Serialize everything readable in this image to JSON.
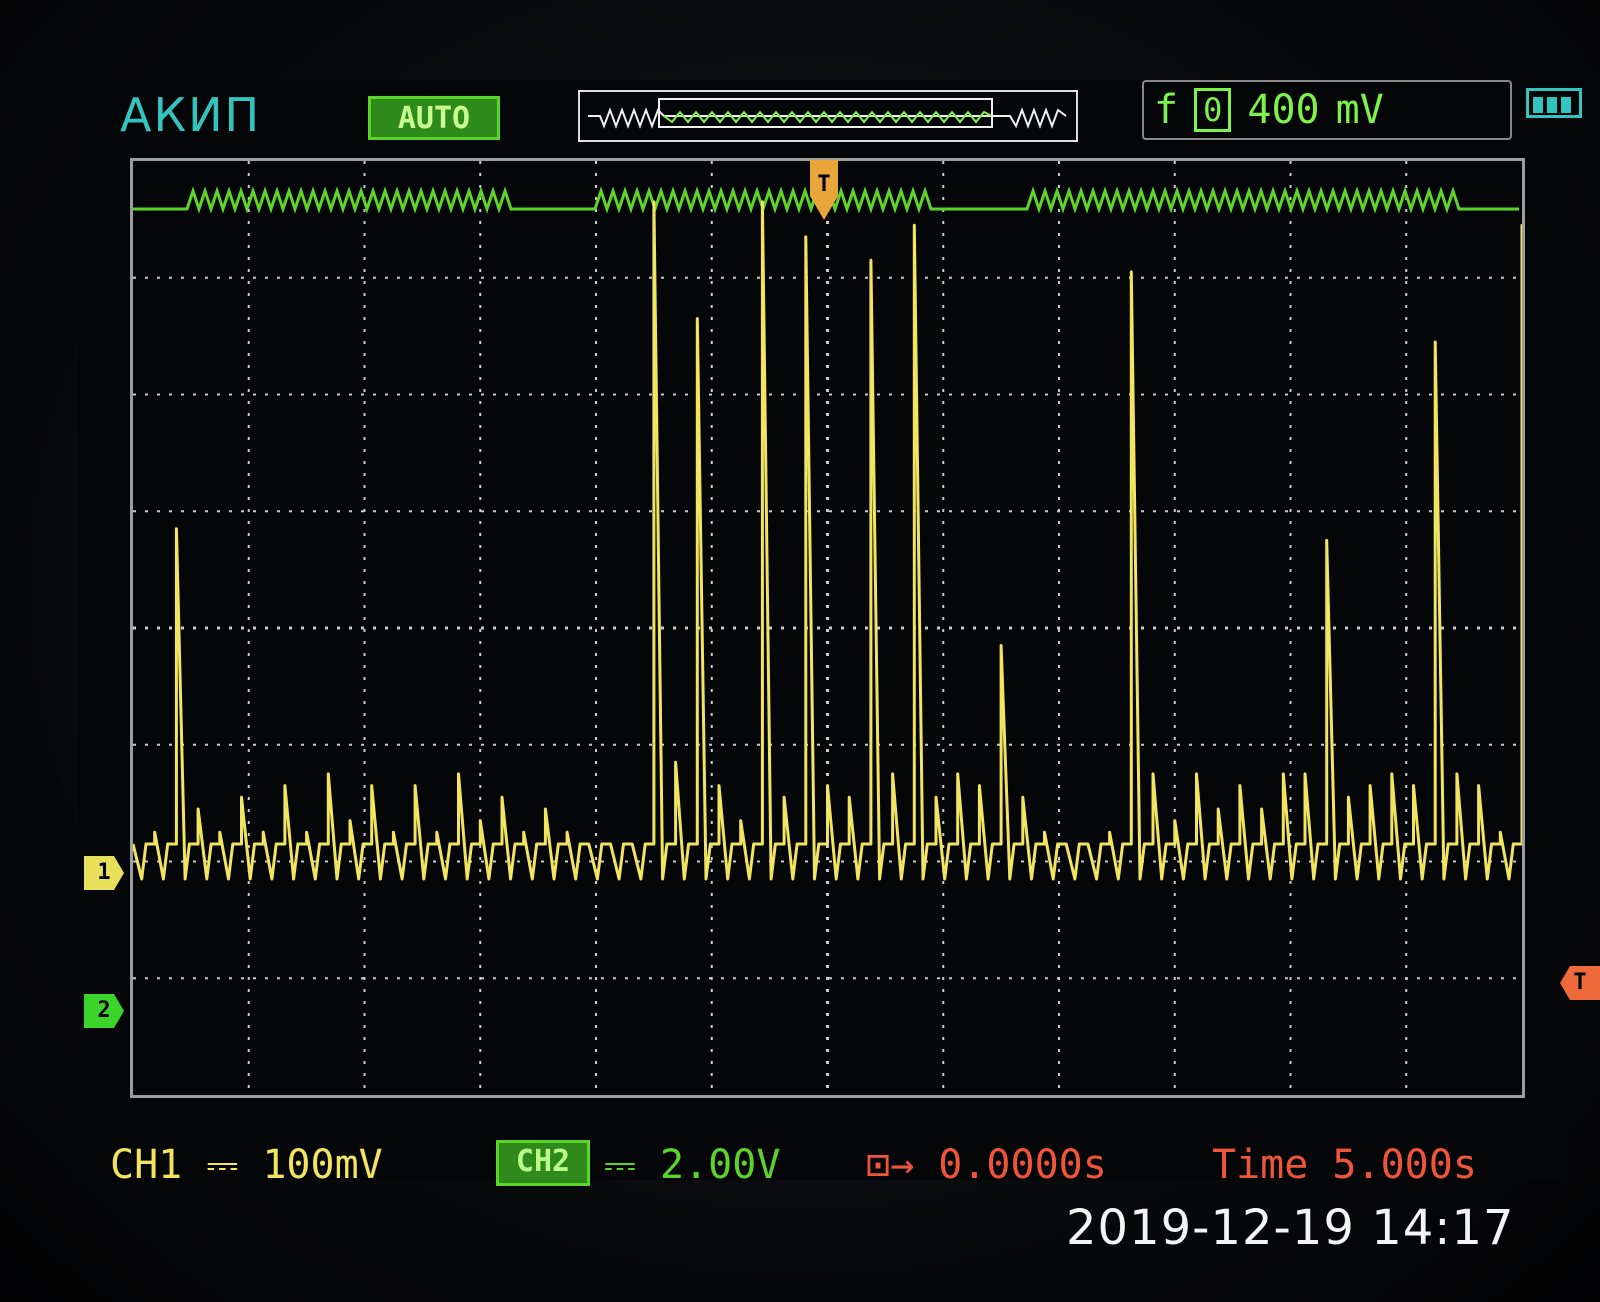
{
  "header": {
    "brand": "АКИП",
    "run_mode": "AUTO",
    "trigger_symbol": "f",
    "trigger_coupling": "0",
    "trigger_level": "400",
    "trigger_unit": "mV"
  },
  "markers": {
    "ch1": "1",
    "ch2": "2",
    "trigger": "T"
  },
  "footer": {
    "ch1_scale": "CH1 ⎓ 100mV",
    "ch2_name": "CH2",
    "ch2_scale": "⎓ 2.00V",
    "horizontal_offset": "⊡→ 0.0000s",
    "time_scale": "Time 5.000s"
  },
  "timestamp": "2019-12-19 14:17",
  "colors": {
    "ch1": "#f2e460",
    "ch2": "#5cd42a",
    "trigger": "#f0553a",
    "brand": "#33c4c0"
  },
  "icons": {
    "battery": "battery-icon",
    "trigger_edge": "trigger-edge-icon"
  },
  "chart_data": {
    "type": "line",
    "grid_divisions": {
      "x": 12,
      "y": 8
    },
    "series": [
      {
        "name": "CH1",
        "values": [
          0.0,
          0.1,
          2.7,
          0.3,
          0.1,
          0.4,
          0.1,
          0.5,
          0.1,
          0.6,
          0.2,
          0.5,
          0.1,
          0.5,
          0.1,
          0.6,
          0.2,
          0.4,
          0.1,
          0.3,
          0.1,
          0.0,
          0.0,
          0.0,
          5.5,
          0.7,
          4.5,
          0.5,
          0.2,
          5.5,
          0.4,
          5.2,
          0.5,
          0.4,
          5.0,
          0.6,
          5.3,
          0.4,
          0.6,
          0.5,
          1.7,
          0.4,
          0.1,
          0.0,
          0.0,
          0.1,
          4.9,
          0.6,
          0.2,
          0.6,
          0.3,
          0.5,
          0.3,
          0.6,
          0.6,
          2.6,
          0.4,
          0.5,
          0.6,
          0.5,
          4.3,
          0.6,
          0.5,
          0.1,
          5.3
        ]
      }
    ]
  }
}
